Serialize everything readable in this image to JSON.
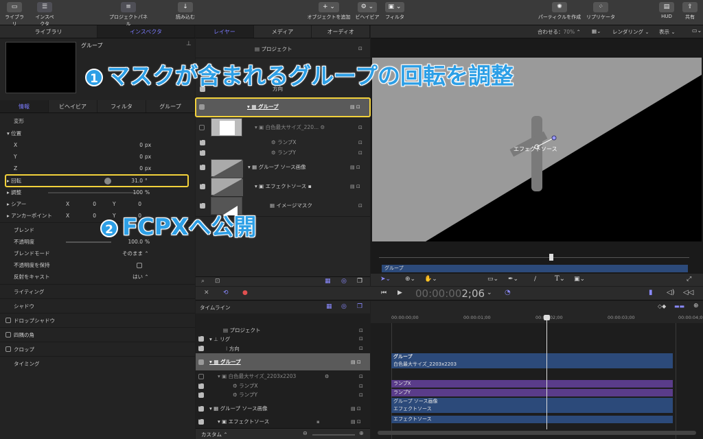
{
  "toolbar": {
    "library": "ライブラリ",
    "inspector": "インスペクタ",
    "project_panel": "プロジェクトパネル",
    "import": "読み込む",
    "add_object": "オブジェクトを追加",
    "behavior": "ビヘイビア",
    "filter": "フィルタ",
    "make_particles": "パーティクルを作成",
    "replicator": "リプリケータ",
    "hud": "HUD",
    "share": "共有"
  },
  "left": {
    "tabs": [
      "ライブラリ",
      "インスペクタ"
    ],
    "preview_title": "グループ",
    "subtabs": [
      "情報",
      "ビヘイビア",
      "フィルタ",
      "グループ"
    ],
    "transform": "変形",
    "position": "位置",
    "x_label": "X",
    "x_value": "0",
    "y_label": "Y",
    "y_value": "0",
    "z_label": "Z",
    "z_value": "0",
    "px": "px",
    "rotation": "回転",
    "rotation_value": "31.0",
    "degree": "°",
    "scale": "調整",
    "scale_value": "100",
    "percent": "%",
    "shear": "シアー",
    "shear_x": "0",
    "shear_y": "0",
    "anchor": "アンカーポイント",
    "anchor_x": "0",
    "anchor_y": "0",
    "blend": "ブレンド",
    "opacity": "不透明度",
    "opacity_value": "100.0",
    "blend_mode": "ブレンドモード",
    "blend_mode_value": "そのまま",
    "preserve_opacity": "不透明度を保持",
    "cast_reflection": "反射をキャスト",
    "cast_reflection_value": "はい",
    "lighting": "ライティング",
    "shading": "シャドウ",
    "drop_shadow": "ドロップシャドウ",
    "four_corner": "四隅の角",
    "crop": "クロップ",
    "timing": "タイミング"
  },
  "layers": {
    "tabs": [
      "レイヤー",
      "メディア",
      "オーディオ"
    ],
    "items": [
      {
        "name": "プロジェクト"
      },
      {
        "name": "方向"
      },
      {
        "name": "グループ"
      },
      {
        "name": "白色最大サイズ_220..."
      },
      {
        "name": "ランプX"
      },
      {
        "name": "ランプY"
      },
      {
        "name": "グループ ソース画像"
      },
      {
        "name": "エフェクトソース"
      },
      {
        "name": "イメージマスク"
      }
    ]
  },
  "canvas": {
    "fit": "合わせる：",
    "zoom": "70%",
    "render": "レンダリング",
    "view": "表示",
    "overlay_label": "エフェクトソース",
    "mini_track": "グループ"
  },
  "timeline": {
    "timecode": "00:00:00:02;06",
    "timecode_dim": "00:00:00",
    "timecode_bright": "2;06",
    "label": "タイムライン",
    "ruler": [
      "00:00:00;00",
      "00:00:01;00",
      "00:00:02;00",
      "00:00:03;00",
      "00:00:04;00"
    ],
    "tracks": [
      {
        "name": "プロジェクト"
      },
      {
        "name": "リグ"
      },
      {
        "name": "方向"
      },
      {
        "name": "グループ"
      },
      {
        "name": "白色最大サイズ_2203x2203"
      },
      {
        "name": "ランプX"
      },
      {
        "name": "ランプY"
      },
      {
        "name": "グループ ソース画像"
      },
      {
        "name": "エフェクトソース"
      }
    ],
    "clips": [
      "グループ",
      "白色最大サイズ_2203x2203",
      "ランプX",
      "ランプY",
      "グループ ソース画像",
      "エフェクトソース",
      "エフェクトソース"
    ],
    "footer": "カスタム"
  },
  "annotations": {
    "one_num": "1",
    "one": "マスクが含まれるグループの回転を調整",
    "two_num": "2",
    "two": "FCPXへ公開"
  }
}
